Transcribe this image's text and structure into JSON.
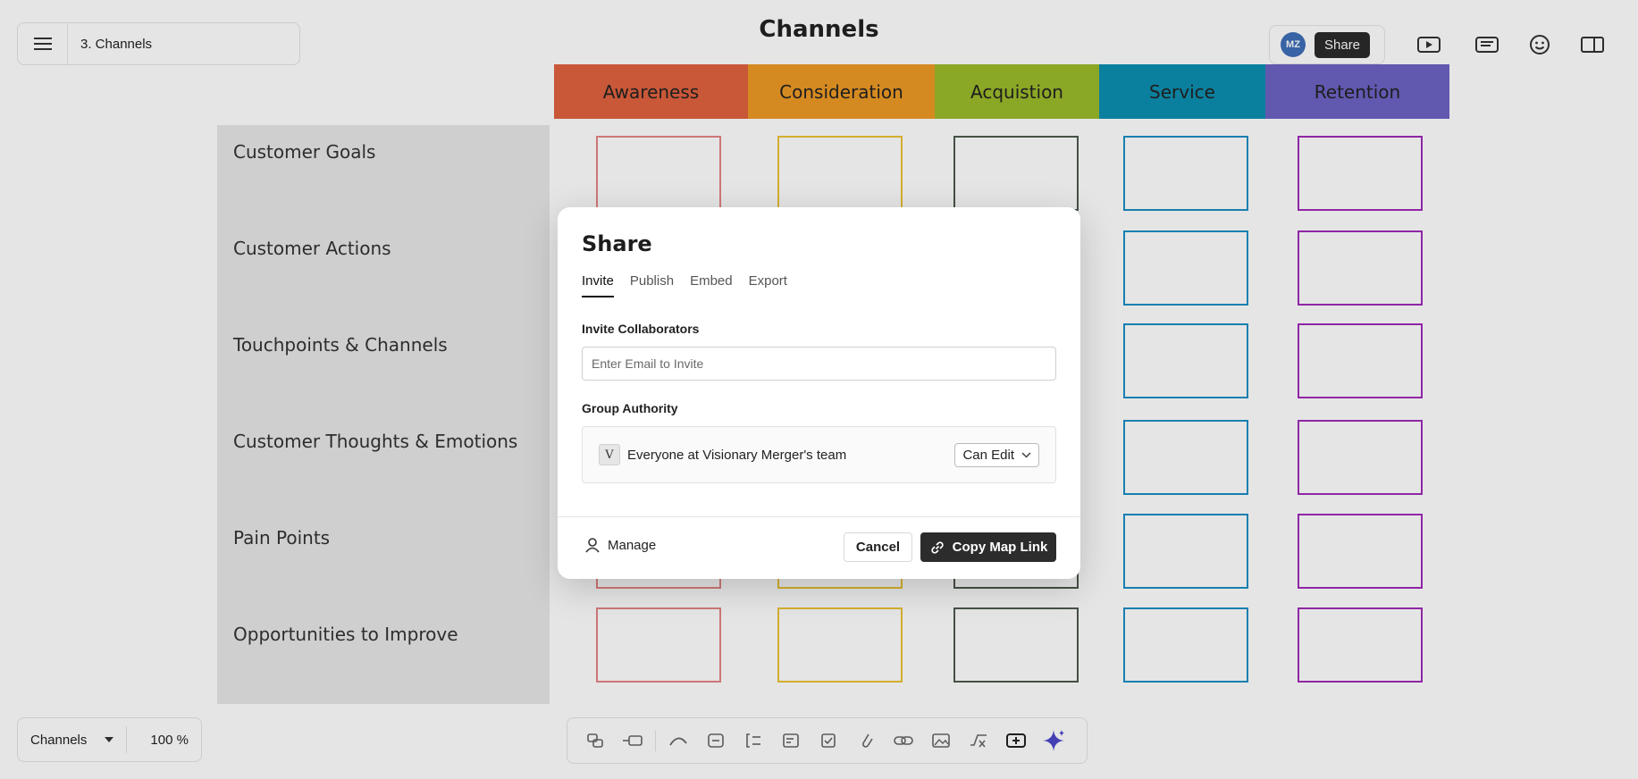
{
  "header": {
    "breadcrumb": "3. Channels",
    "page_title": "Channels",
    "avatar_initials": "MZ",
    "share_label": "Share"
  },
  "stages": [
    {
      "label": "Awareness",
      "color": "#e0633f"
    },
    {
      "label": "Consideration",
      "color": "#ee9a25"
    },
    {
      "label": "Acquistion",
      "color": "#9bba2b"
    },
    {
      "label": "Service",
      "color": "#0d8fb0"
    },
    {
      "label": "Retention",
      "color": "#6c63c5"
    }
  ],
  "rows": [
    "Customer Goals",
    "Customer Actions",
    "Touchpoints & Channels",
    "Customer Thoughts & Emotions",
    "Pain Points",
    "Opportunities to Improve"
  ],
  "card_colors": [
    "#e68585",
    "#ecc233",
    "#4d5a4d",
    "#1a8ec5",
    "#a02bb8"
  ],
  "bottom_left": {
    "view_select": "Channels",
    "zoom": "100 %"
  },
  "dialog": {
    "title": "Share",
    "tabs": [
      "Invite",
      "Publish",
      "Embed",
      "Export"
    ],
    "invite_label": "Invite Collaborators",
    "email_placeholder": "Enter Email to Invite",
    "group_label": "Group Authority",
    "team_initial": "V",
    "team_name": "Everyone at Visionary Merger's team",
    "permission": "Can Edit",
    "manage_label": "Manage",
    "cancel_label": "Cancel",
    "copy_label": "Copy Map Link"
  },
  "toolbar_icons": [
    "connect-icon",
    "align-icon",
    "curve-icon",
    "frame-icon",
    "bracket-icon",
    "edit-list-icon",
    "checkbox-icon",
    "link-icon",
    "chain-icon",
    "image-icon",
    "formula-icon",
    "add-card-icon",
    "ai-sparkle-icon"
  ]
}
